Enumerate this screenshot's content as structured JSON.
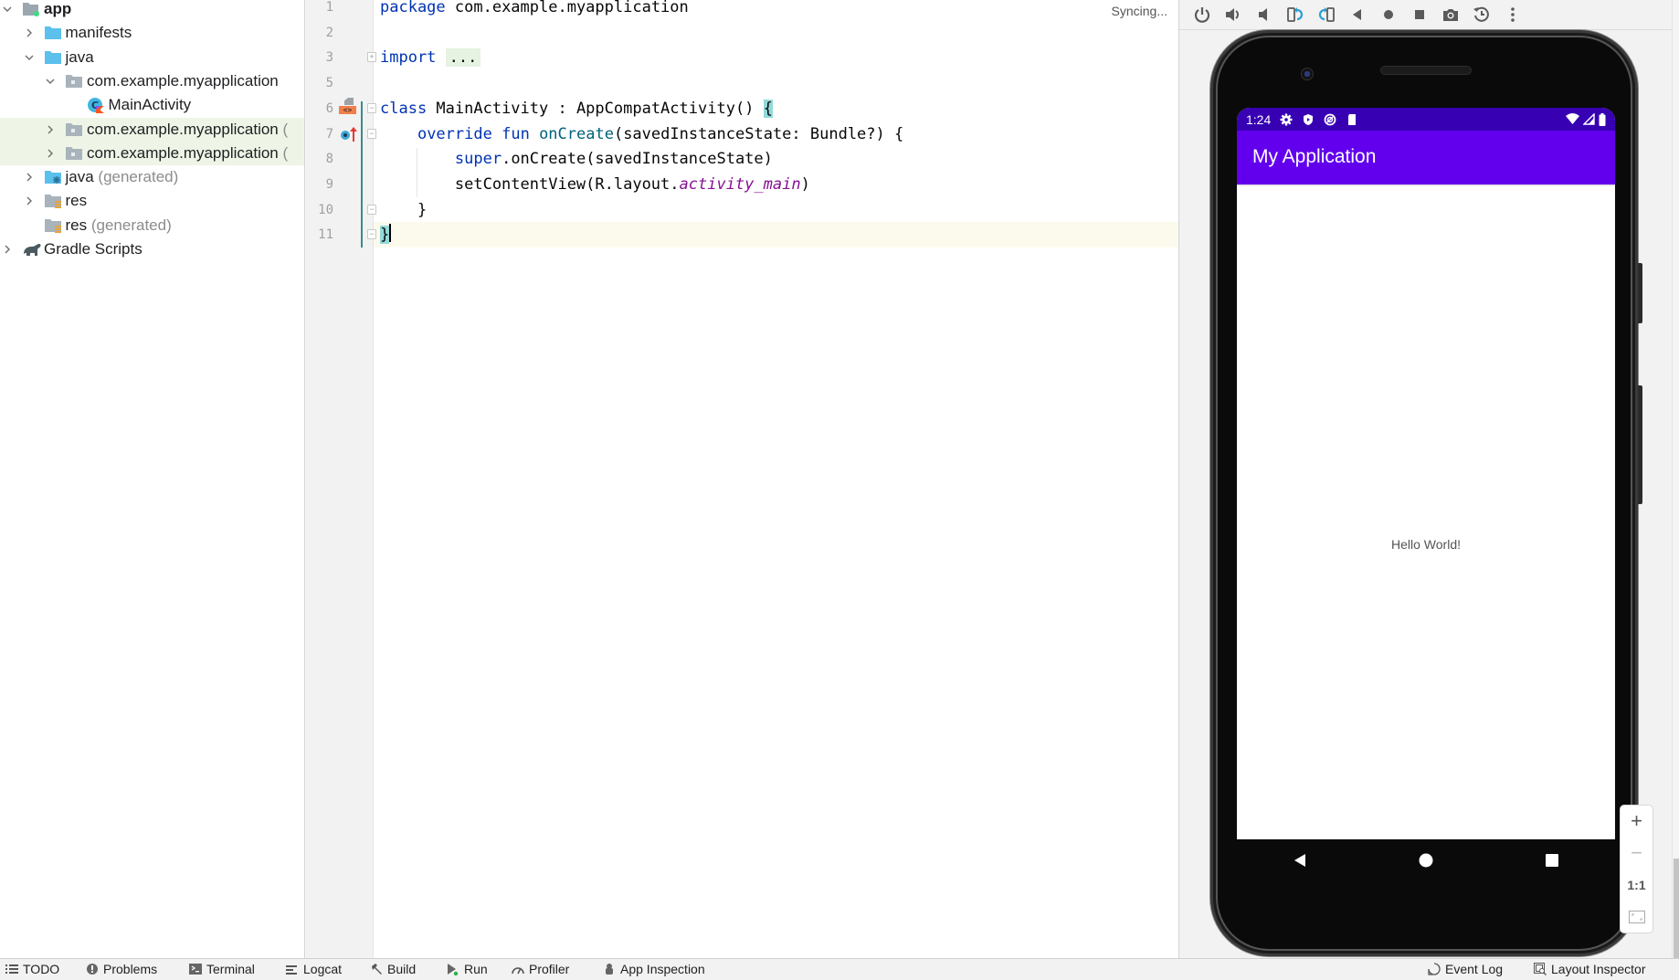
{
  "project_tree": [
    {
      "label": "app",
      "muted": "",
      "expanded": true,
      "bold": true,
      "icon": "module-folder-icon",
      "depth": 0
    },
    {
      "label": "manifests",
      "muted": "",
      "expanded": false,
      "icon": "folder-icon",
      "depth": 1
    },
    {
      "label": "java",
      "muted": "",
      "expanded": true,
      "icon": "folder-icon",
      "depth": 1
    },
    {
      "label": "com.example.myapplication",
      "muted": "",
      "expanded": true,
      "icon": "package-icon",
      "depth": 2
    },
    {
      "label": "MainActivity",
      "muted": "",
      "expanded": null,
      "icon": "kotlin-class-icon",
      "depth": 3
    },
    {
      "label": "com.example.myapplication",
      "muted": "(",
      "expanded": false,
      "icon": "package-icon",
      "depth": 2,
      "highlight": true
    },
    {
      "label": "com.example.myapplication",
      "muted": "(",
      "expanded": false,
      "icon": "package-icon",
      "depth": 2,
      "highlight": true
    },
    {
      "label": "java",
      "muted": "(generated)",
      "expanded": false,
      "icon": "generated-folder-icon",
      "depth": 1
    },
    {
      "label": "res",
      "muted": "",
      "expanded": false,
      "icon": "res-folder-icon",
      "depth": 1
    },
    {
      "label": "res",
      "muted": "(generated)",
      "expanded": null,
      "icon": "res-folder-icon",
      "depth": 1
    },
    {
      "label": "Gradle Scripts",
      "muted": "",
      "expanded": false,
      "icon": "gradle-icon",
      "depth": 0
    }
  ],
  "editor": {
    "status": "Syncing...",
    "line_numbers": [
      "1",
      "2",
      "3",
      "5",
      "6",
      "7",
      "8",
      "9",
      "10",
      "11"
    ],
    "lines": [
      [
        {
          "t": "package",
          "c": "kw"
        },
        {
          "t": " com.example.myapplication",
          "c": ""
        }
      ],
      [],
      [
        {
          "t": "import",
          "c": "kw"
        },
        {
          "t": " ",
          "c": ""
        },
        {
          "t": "...",
          "c": "fold-box"
        }
      ],
      [],
      [
        {
          "t": "class",
          "c": "kw"
        },
        {
          "t": " MainActivity : AppCompatActivity() ",
          "c": ""
        },
        {
          "t": "{",
          "c": "brace-hl"
        }
      ],
      [
        {
          "t": "    ",
          "c": ""
        },
        {
          "t": "override",
          "c": "kw"
        },
        {
          "t": " ",
          "c": ""
        },
        {
          "t": "fun",
          "c": "kw"
        },
        {
          "t": " ",
          "c": ""
        },
        {
          "t": "onCreate",
          "c": "fn"
        },
        {
          "t": "(savedInstanceState: Bundle?) {",
          "c": ""
        }
      ],
      [
        {
          "t": "        ",
          "c": ""
        },
        {
          "t": "super",
          "c": "kw"
        },
        {
          "t": ".onCreate(savedInstanceState)",
          "c": ""
        }
      ],
      [
        {
          "t": "        setContentView(R.layout.",
          "c": ""
        },
        {
          "t": "activity_main",
          "c": "it"
        },
        {
          "t": ")",
          "c": ""
        }
      ],
      [
        {
          "t": "    }",
          "c": ""
        }
      ],
      [
        {
          "t": "}",
          "c": "brace-hl"
        }
      ]
    ]
  },
  "emulator": {
    "toolbar": [
      "power-icon",
      "volume-up-icon",
      "volume-down-icon",
      "rotate-left-icon",
      "rotate-right-icon",
      "back-icon",
      "home-icon",
      "overview-icon",
      "screenshot-icon",
      "snapshot-icon",
      "more-icon"
    ],
    "status_time": "1:24",
    "app_title": "My Application",
    "hello_text": "Hello World!",
    "zoom": {
      "plus": "+",
      "minus": "−",
      "actual": "1:1"
    }
  },
  "bottom_bar": {
    "left": [
      {
        "label": "TODO",
        "icon": "list-icon"
      },
      {
        "label": "Problems",
        "icon": "problems-icon"
      },
      {
        "label": "Terminal",
        "icon": "terminal-icon"
      },
      {
        "label": "Logcat",
        "icon": "logcat-icon"
      },
      {
        "label": "Build",
        "icon": "hammer-icon"
      },
      {
        "label": "Run",
        "icon": "run-icon"
      },
      {
        "label": "Profiler",
        "icon": "profiler-icon"
      },
      {
        "label": "App Inspection",
        "icon": "app-inspection-icon"
      }
    ],
    "right": [
      {
        "label": "Event Log",
        "icon": "event-log-icon"
      },
      {
        "label": "Layout Inspector",
        "icon": "layout-inspector-icon"
      }
    ]
  },
  "colors": {
    "status_bar": "#3700b3",
    "app_bar": "#6200ee",
    "keyword": "#0033b3",
    "highlight_row": "#eef5e6"
  }
}
